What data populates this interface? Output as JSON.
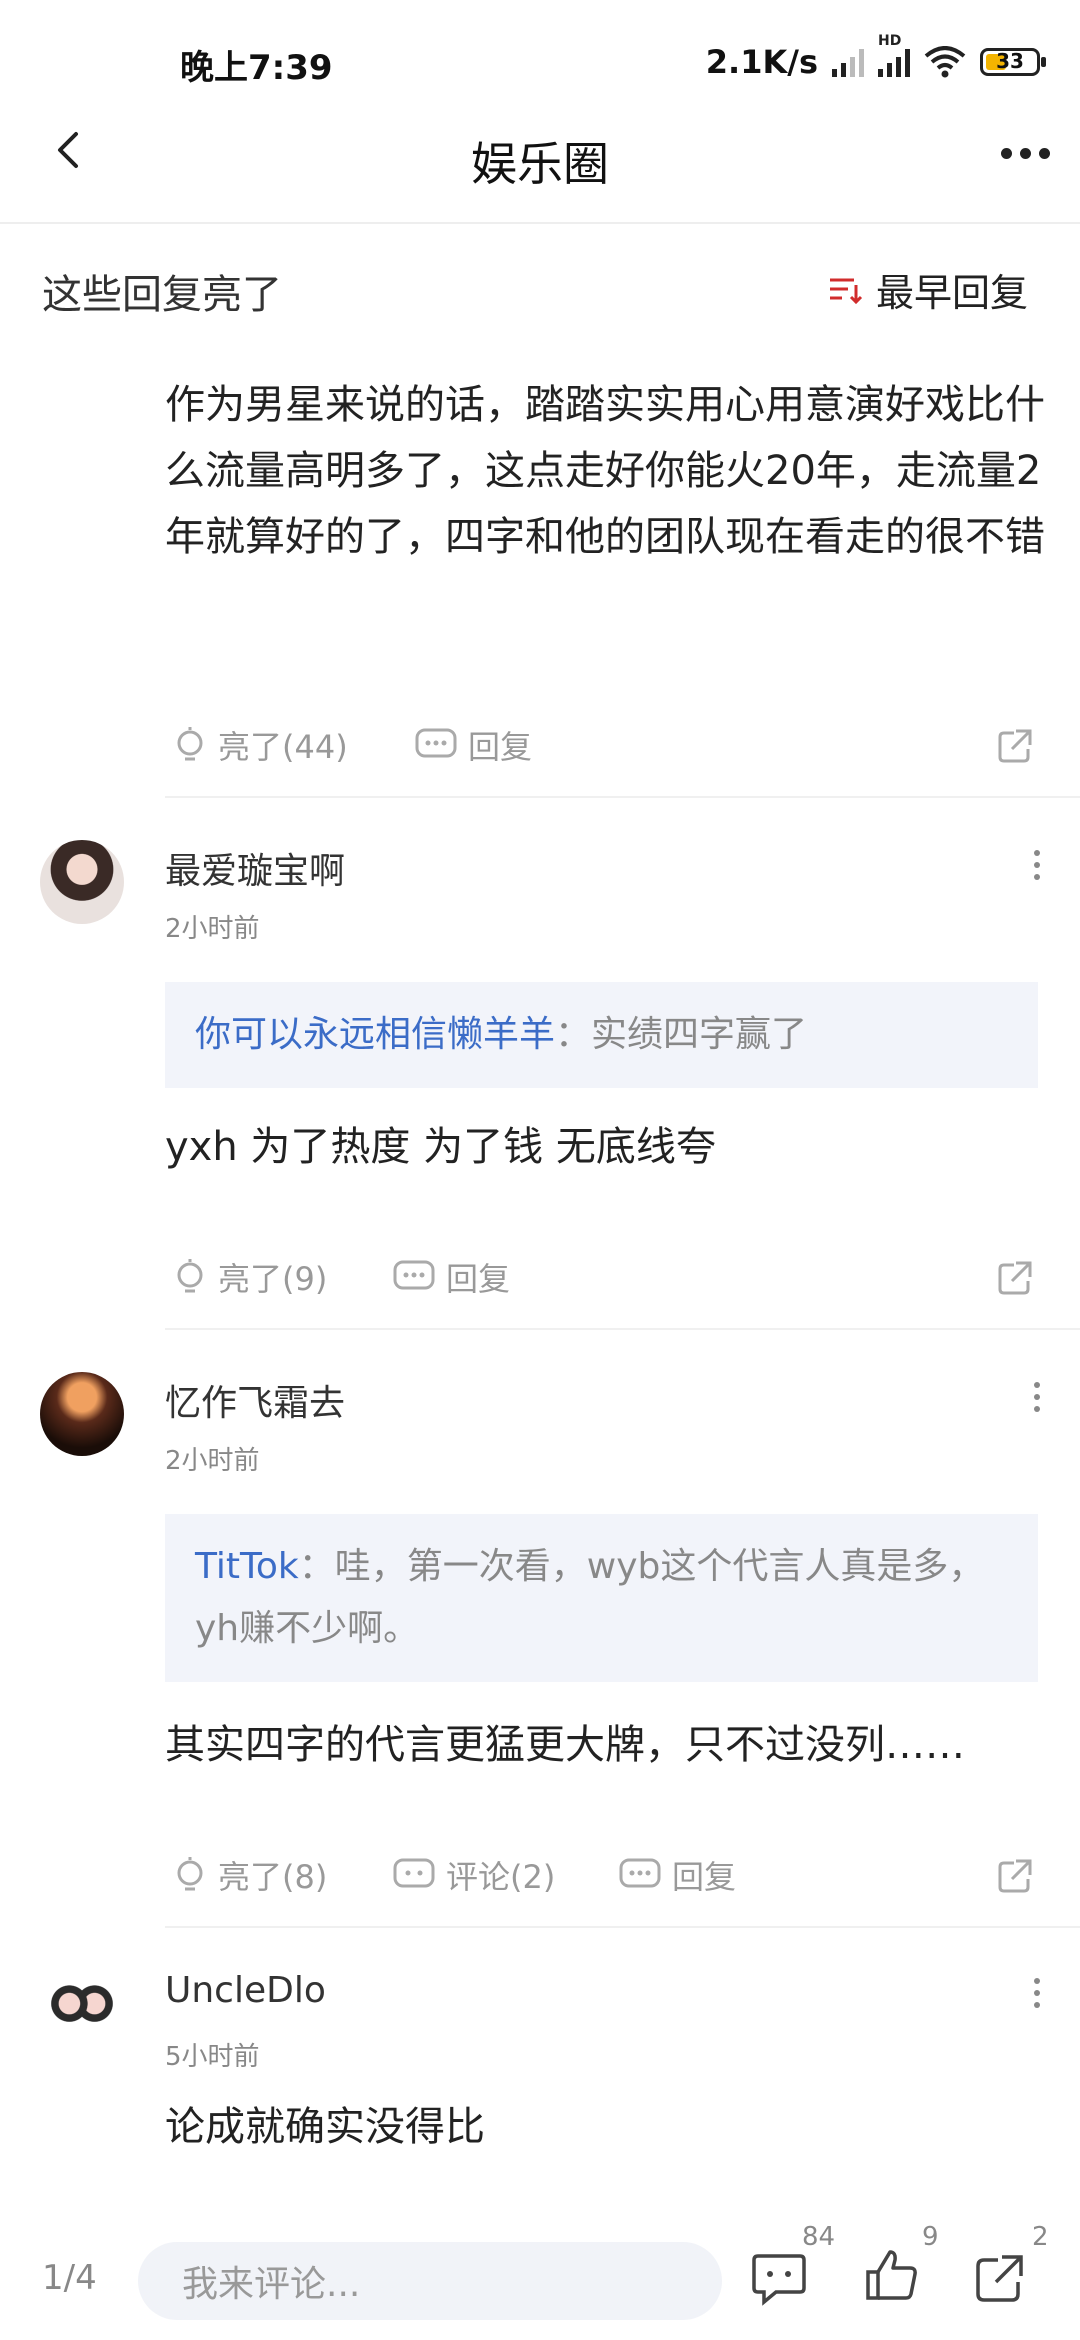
{
  "status_bar": {
    "time": "晚上7:39",
    "net_speed": "2.1K/s",
    "hd_label": "HD",
    "battery": "33"
  },
  "header": {
    "title": "娱乐圈"
  },
  "section": {
    "title": "这些回复亮了",
    "sort_label": "最早回复"
  },
  "main_post": {
    "text": "作为男星来说的话，踏踏实实用心用意演好戏比什么流量高明多了，这点走好你能火20年，走流量2年就算好的了，四字和他的团队现在看走的很不错",
    "like_label": "亮了(44)",
    "reply_label": "回复"
  },
  "comments": [
    {
      "username": "最爱璇宝啊",
      "time": "2小时前",
      "quote_name": "你可以永远相信懒羊羊",
      "quote_text": "：实绩四字赢了",
      "text": "yxh 为了热度 为了钱 无底线夸",
      "like_label": "亮了(9)",
      "reply_label": "回复"
    },
    {
      "username": "忆作飞霜去",
      "time": "2小时前",
      "quote_name": "TitTok",
      "quote_text": "：哇，第一次看，wyb这个代言人真是多，yh赚不少啊。",
      "text": "其实四字的代言更猛更大牌，只不过没列……",
      "like_label": "亮了(8)",
      "comment_label": "评论(2)",
      "reply_label": "回复"
    },
    {
      "username": "UncleDlo",
      "time": "5小时前",
      "text": "论成就确实没得比"
    }
  ],
  "bottom_bar": {
    "page_indicator": "1/4",
    "input_placeholder": "我来评论...",
    "comment_count": "84",
    "like_count": "9",
    "share_count": "2"
  },
  "colors": {
    "accent_blue": "#3b6cc7",
    "quote_bg": "#f2f4fa",
    "sort_icon_red": "#d12c2c"
  }
}
